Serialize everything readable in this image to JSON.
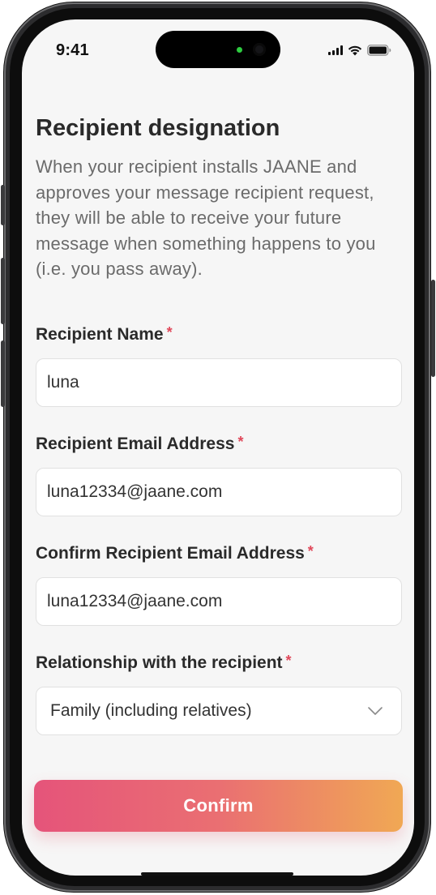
{
  "status_bar": {
    "time": "9:41"
  },
  "page": {
    "title": "Recipient designation",
    "description": "When your recipient installs JAANE and approves your message recipient request, they will be able to receive your future message when something happens to you (i.e. you pass away)."
  },
  "form": {
    "required_marker": "*",
    "recipient_name": {
      "label": "Recipient Name",
      "value": "luna"
    },
    "recipient_email": {
      "label": "Recipient Email Address",
      "value": "luna12334@jaane.com"
    },
    "confirm_email": {
      "label": "Confirm Recipient Email Address",
      "value": "luna12334@jaane.com"
    },
    "relationship": {
      "label": "Relationship with the recipient",
      "selected": "Family (including relatives)"
    }
  },
  "actions": {
    "confirm_label": "Confirm"
  },
  "colors": {
    "required": "#e0485a",
    "button_gradient_start": "#e5547a",
    "button_gradient_end": "#f0a854"
  }
}
